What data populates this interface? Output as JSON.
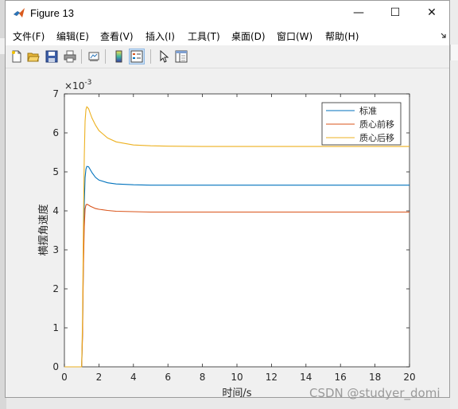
{
  "window": {
    "title": "Figure 13",
    "minimize_glyph": "—",
    "maximize_glyph": "☐",
    "close_glyph": "✕"
  },
  "menu": [
    "文件(F)",
    "编辑(E)",
    "查看(V)",
    "插入(I)",
    "工具(T)",
    "桌面(D)",
    "窗口(W)",
    "帮助(H)"
  ],
  "toolbar": {
    "icons": [
      "new-figure-icon",
      "open-file-icon",
      "save-icon",
      "print-icon",
      "link-plot-icon",
      "colorbar-icon",
      "legend-icon",
      "pointer-icon",
      "property-editor-icon"
    ]
  },
  "chart_data": {
    "type": "line",
    "xlabel": "时间/s",
    "ylabel": "横摆角速度",
    "exponent_label": "×10",
    "exponent_power": "-3",
    "xlim": [
      0,
      20
    ],
    "ylim": [
      0,
      7
    ],
    "xticks": [
      "0",
      "2",
      "4",
      "6",
      "8",
      "10",
      "12",
      "14",
      "16",
      "18",
      "20"
    ],
    "yticks": [
      "0",
      "1",
      "2",
      "3",
      "4",
      "5",
      "6",
      "7"
    ],
    "legend_position": "top-right",
    "grid": false,
    "series": [
      {
        "name": "标准",
        "color": "#0072bd",
        "x": [
          0,
          1.0,
          1.05,
          1.1,
          1.15,
          1.2,
          1.25,
          1.3,
          1.4,
          1.5,
          1.6,
          1.8,
          2.0,
          2.5,
          3.0,
          4.0,
          5.0,
          6.0,
          8.0,
          10.0,
          14.0,
          20.0
        ],
        "y": [
          0,
          0,
          0.9,
          2.8,
          4.2,
          4.85,
          5.07,
          5.14,
          5.13,
          5.06,
          4.98,
          4.86,
          4.79,
          4.72,
          4.69,
          4.67,
          4.66,
          4.66,
          4.66,
          4.66,
          4.66,
          4.66
        ]
      },
      {
        "name": "质心前移",
        "color": "#d95319",
        "x": [
          0,
          1.0,
          1.05,
          1.1,
          1.15,
          1.2,
          1.25,
          1.3,
          1.4,
          1.5,
          1.6,
          1.8,
          2.0,
          2.5,
          3.0,
          4.0,
          5.0,
          6.0,
          8.0,
          10.0,
          14.0,
          20.0
        ],
        "y": [
          0,
          0,
          0.8,
          2.6,
          3.6,
          4.05,
          4.15,
          4.17,
          4.15,
          4.12,
          4.1,
          4.06,
          4.04,
          4.01,
          3.99,
          3.98,
          3.97,
          3.97,
          3.97,
          3.97,
          3.97,
          3.97
        ]
      },
      {
        "name": "质心后移",
        "color": "#edb120",
        "x": [
          0,
          1.0,
          1.05,
          1.1,
          1.15,
          1.2,
          1.25,
          1.3,
          1.4,
          1.5,
          1.6,
          1.8,
          2.0,
          2.5,
          3.0,
          4.0,
          5.0,
          6.0,
          8.0,
          10.0,
          14.0,
          20.0
        ],
        "y": [
          0,
          0,
          1.2,
          3.6,
          5.4,
          6.3,
          6.6,
          6.67,
          6.62,
          6.5,
          6.38,
          6.2,
          6.06,
          5.87,
          5.77,
          5.69,
          5.67,
          5.66,
          5.65,
          5.65,
          5.65,
          5.65
        ]
      }
    ]
  },
  "watermark": "CSDN @studyer_domi"
}
